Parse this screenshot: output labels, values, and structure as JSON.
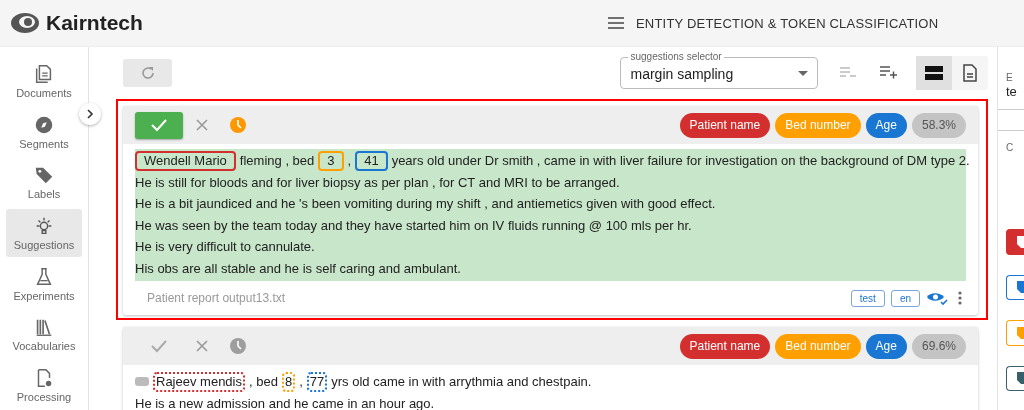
{
  "header": {
    "brand": "Kairntech",
    "title": "ENTITY DETECTION & TOKEN CLASSIFICATION"
  },
  "sidebar": {
    "items": [
      {
        "label": "Documents",
        "selected": false
      },
      {
        "label": "Segments",
        "selected": false
      },
      {
        "label": "Labels",
        "selected": false
      },
      {
        "label": "Suggestions",
        "selected": true
      },
      {
        "label": "Experiments",
        "selected": false
      },
      {
        "label": "Vocabularies",
        "selected": false
      },
      {
        "label": "Processing",
        "selected": false
      }
    ]
  },
  "toolbar": {
    "selector": {
      "label": "suggestions selector",
      "value": "margin sampling"
    },
    "view_modes": [
      {
        "selected": true
      },
      {
        "selected": false
      }
    ]
  },
  "cards": [
    {
      "selected": true,
      "accepted": true,
      "score": "58.3%",
      "labels": [
        {
          "kind": "patient_name",
          "text": "Patient name",
          "color": "#d32f2f"
        },
        {
          "kind": "bed_number",
          "text": "Bed number",
          "color": "#ffa000"
        },
        {
          "kind": "age",
          "text": "Age",
          "color": "#1976d2"
        }
      ],
      "lines": [
        [
          {
            "text": "Wendell Mario",
            "kind": "patient_name"
          },
          {
            "text": "fleming , bed"
          },
          {
            "text": "3",
            "kind": "bed_number"
          },
          {
            "text": ","
          },
          {
            "text": "41",
            "kind": "age"
          },
          {
            "text": "years old under Dr smith , came in with liver failure for investigation on the background of DM type 2."
          }
        ],
        [
          {
            "text": "He is still for bloods and for liver biopsy as per plan , for CT and MRI to be arranged."
          }
        ],
        [
          {
            "text": "He is a bit jaundiced and he 's been vomiting during my shift , and antiemetics given with good effect."
          }
        ],
        [
          {
            "text": "He was seen by the team today and they have started him on IV fluids running @ 100 mls per hr."
          }
        ],
        [
          {
            "text": "He is very difficult to cannulate."
          }
        ],
        [
          {
            "text": "His obs are all stable and he is self caring and ambulant."
          }
        ]
      ],
      "filename": "Patient report output13.txt",
      "tags": [
        "test",
        "en"
      ]
    },
    {
      "selected": false,
      "accepted": false,
      "score": "69.6%",
      "labels": [
        {
          "kind": "patient_name",
          "text": "Patient name",
          "color": "#d32f2f"
        },
        {
          "kind": "bed_number",
          "text": "Bed number",
          "color": "#ffa000"
        },
        {
          "kind": "age",
          "text": "Age",
          "color": "#1976d2"
        }
      ],
      "lines": [
        [
          {
            "text": "Rajeev mendis",
            "kind": "patient_name"
          },
          {
            "text": ", bed"
          },
          {
            "text": "8",
            "kind": "bed_number"
          },
          {
            "text": ","
          },
          {
            "text": "77",
            "kind": "age"
          },
          {
            "text": "yrs old came in with arrythmia and chestpain."
          }
        ],
        [
          {
            "text": "He is a new admission and he came in an hour ago."
          }
        ]
      ]
    }
  ],
  "right_panel": {
    "texts": [
      "E",
      "te",
      "C"
    ],
    "label_buttons": [
      {
        "color": "#d32f2f",
        "filled": true
      },
      {
        "color": "#1976d2",
        "filled": false
      },
      {
        "color": "#ffa000",
        "filled": false
      },
      {
        "color": "#37606b",
        "filled": false
      }
    ]
  }
}
